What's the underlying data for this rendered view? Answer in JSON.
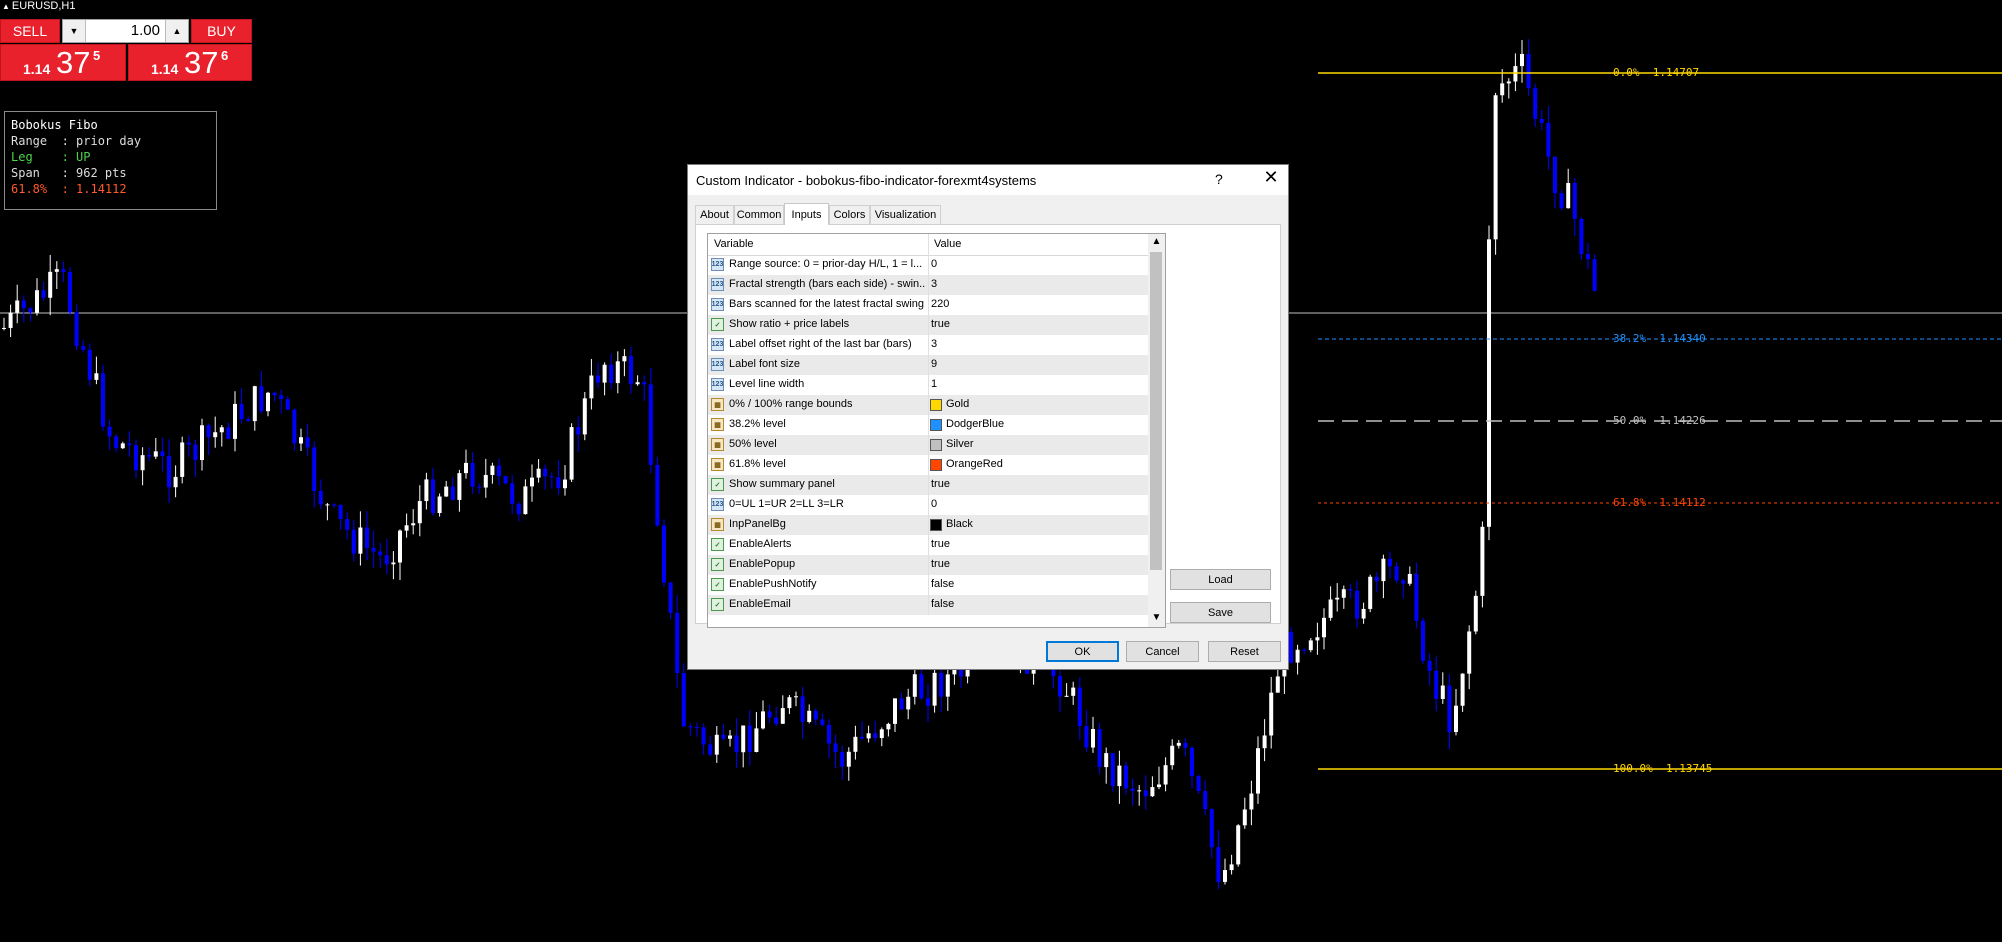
{
  "chart": {
    "symbol": "EURUSD,H1",
    "trade_panel": {
      "sell_label": "SELL",
      "buy_label": "BUY",
      "lot": "1.00",
      "bid": {
        "a": "1.14",
        "b": "37",
        "c": "5"
      },
      "ask": {
        "a": "1.14",
        "b": "37",
        "c": "6"
      }
    },
    "summary": {
      "title": "Bobokus Fibo",
      "range": "Range  : prior day",
      "leg": "Leg    : UP",
      "span": "Span   : 962 pts",
      "level": "61.8%  : 1.14112"
    },
    "fib_levels": [
      {
        "label": "0.0%  1.14707",
        "color": "#FFD700"
      },
      {
        "label": "38.2%  1.14340",
        "color": "#1E90FF"
      },
      {
        "label": "50.0%  1.14226",
        "color": "#C0C0C0"
      },
      {
        "label": "61.8%  1.14112",
        "color": "#FF4500"
      },
      {
        "label": "100.0%  1.13745",
        "color": "#FFD700"
      }
    ],
    "colors": {
      "bull": "#ffffff",
      "bear": "#0000ff",
      "background": "#000000"
    }
  },
  "dialog": {
    "title": "Custom Indicator - bobokus-fibo-indicator-forexmt4systems",
    "help": "?",
    "close": "✕",
    "tabs": [
      "About",
      "Common",
      "Inputs",
      "Colors",
      "Visualization"
    ],
    "active_tab": "Inputs",
    "columns": {
      "variable": "Variable",
      "value": "Value"
    },
    "rows": [
      {
        "type": "num",
        "icon": "123",
        "variable": "Range source: 0 = prior-day H/L, 1 = l...",
        "value": "0"
      },
      {
        "type": "num",
        "icon": "123",
        "variable": "Fractal strength (bars each side) - swin...",
        "value": "3"
      },
      {
        "type": "num",
        "icon": "123",
        "variable": "Bars scanned for the latest fractal swing",
        "value": "220"
      },
      {
        "type": "bool",
        "icon": "✓",
        "variable": "Show ratio + price labels",
        "value": "true"
      },
      {
        "type": "num",
        "icon": "123",
        "variable": "Label offset right of the last bar (bars)",
        "value": "3"
      },
      {
        "type": "num",
        "icon": "123",
        "variable": "Label font size",
        "value": "9"
      },
      {
        "type": "num",
        "icon": "123",
        "variable": "Level line width",
        "value": "1"
      },
      {
        "type": "col",
        "icon": "▦",
        "variable": "0% / 100% range bounds",
        "value": "Gold",
        "swatch": "#FFD700"
      },
      {
        "type": "col",
        "icon": "▦",
        "variable": "38.2% level",
        "value": "DodgerBlue",
        "swatch": "#1E90FF"
      },
      {
        "type": "col",
        "icon": "▦",
        "variable": "50% level",
        "value": "Silver",
        "swatch": "#C0C0C0"
      },
      {
        "type": "col",
        "icon": "▦",
        "variable": "61.8% level",
        "value": "OrangeRed",
        "swatch": "#FF4500"
      },
      {
        "type": "bool",
        "icon": "✓",
        "variable": "Show summary panel",
        "value": "true"
      },
      {
        "type": "num",
        "icon": "123",
        "variable": "0=UL 1=UR 2=LL 3=LR",
        "value": "0"
      },
      {
        "type": "col",
        "icon": "▦",
        "variable": "InpPanelBg",
        "value": "Black",
        "swatch": "#000000"
      },
      {
        "type": "bool",
        "icon": "✓",
        "variable": "EnableAlerts",
        "value": "true"
      },
      {
        "type": "bool",
        "icon": "✓",
        "variable": "EnablePopup",
        "value": "true"
      },
      {
        "type": "bool",
        "icon": "✓",
        "variable": "EnablePushNotify",
        "value": "false"
      },
      {
        "type": "bool",
        "icon": "✓",
        "variable": "EnableEmail",
        "value": "false"
      }
    ],
    "buttons": {
      "load": "Load",
      "save": "Save",
      "ok": "OK",
      "cancel": "Cancel",
      "reset": "Reset"
    }
  }
}
